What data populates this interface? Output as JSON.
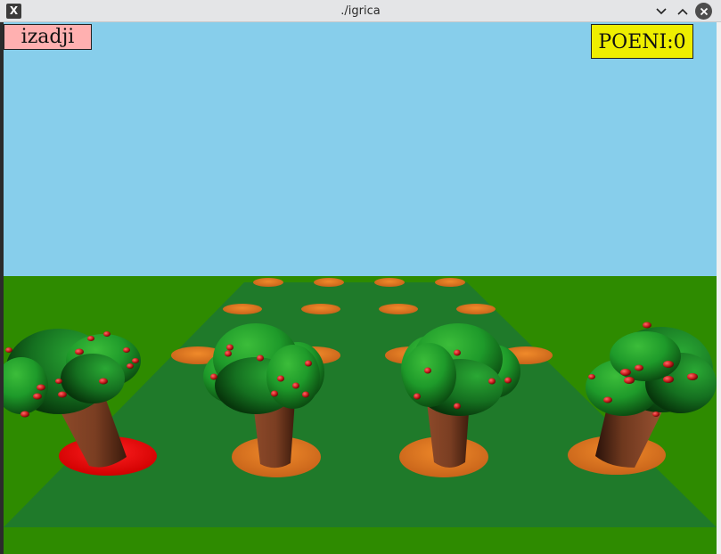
{
  "window": {
    "title": "./igrica",
    "icon": "x-window-icon"
  },
  "game": {
    "exit_label": "izadji",
    "score_label": "POENI:",
    "score_value": "0"
  },
  "colors": {
    "sky": "#87ceeb",
    "ground": "#2e8b00",
    "field": "#1f7a2a",
    "hole": "#e07820",
    "active_hole": "#ff0000",
    "trunk": "#7a3e22",
    "foliage": "#1e9a2a",
    "fruit": "#cc1f1f"
  }
}
